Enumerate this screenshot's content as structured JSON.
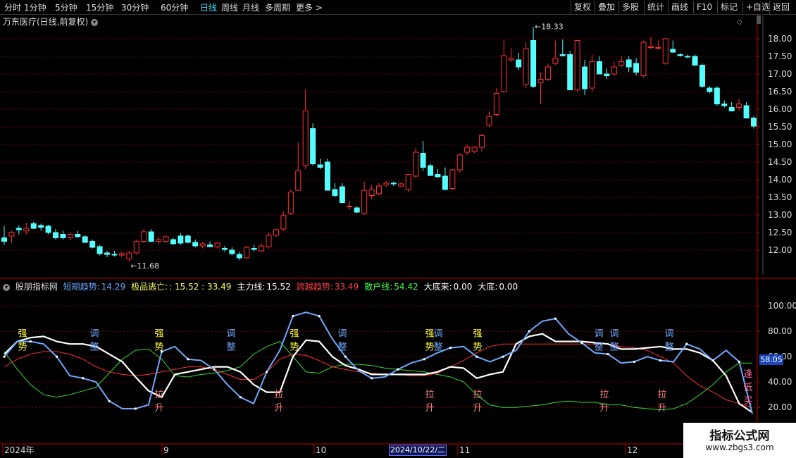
{
  "toolbar": {
    "tabs": [
      "分时",
      "1分钟",
      "5分钟",
      "15分钟",
      "30分钟",
      "60分钟",
      "日线",
      "周线",
      "月线",
      "多周期",
      "更多 >"
    ],
    "active_tab": "日线",
    "right_buttons": [
      "复权",
      "叠加",
      "多股",
      "统计",
      "画线",
      "F10",
      "标记",
      "+自选",
      "返回"
    ]
  },
  "stock_title": "万东医疗(日线,前复权)",
  "indicator_header": {
    "name": "股朋指标网",
    "items": [
      {
        "label": "短期趋势:",
        "value": "14.29",
        "color": "#6fa8ff"
      },
      {
        "label": "极品逃亡:",
        "value": ": 15.52 : 33.49",
        "color": "#ffff66"
      },
      {
        "label": "主力线:",
        "value": "15.52",
        "color": "#ffffff"
      },
      {
        "label": "跨越趋势:",
        "value": "33.49",
        "color": "#ff4444"
      },
      {
        "label": "散户线:",
        "value": "54.42",
        "color": "#44ff44"
      },
      {
        "label": "大底来:",
        "value": "0.00",
        "color": "#ffffff"
      },
      {
        "label": "大底:",
        "value": "0.00",
        "color": "#ffffff"
      }
    ]
  },
  "current_value_badge": "58.05",
  "date_badge": "2024/10/22/二",
  "watermark": {
    "title": "指标公式网",
    "url": "www.zbgs3.com"
  },
  "colors": {
    "up": "#ff3232",
    "down": "#54ffff",
    "grid": "#7a0000",
    "axis": "#c00000",
    "short": "#6fa8ff",
    "main": "#ffffff",
    "cross": "#ff3030",
    "retail": "#33dd33"
  },
  "chart_data": [
    {
      "type": "candlestick",
      "title": "万东医疗(日线,前复权)",
      "y_ticks": [
        12.0,
        12.5,
        13.0,
        13.5,
        14.0,
        14.5,
        15.0,
        15.5,
        16.0,
        16.5,
        17.0,
        17.5,
        18.0
      ],
      "ylim": [
        11.5,
        18.4
      ],
      "x_labels": [
        "2024年",
        "9",
        "10",
        "11",
        "12"
      ],
      "annotations": [
        {
          "text": "18.33",
          "price": 18.33
        },
        {
          "text": "11.68",
          "price": 11.68
        }
      ],
      "candles": [
        [
          12.35,
          12.68,
          12.15,
          12.25
        ],
        [
          12.4,
          12.55,
          12.2,
          12.5
        ],
        [
          12.62,
          12.7,
          12.45,
          12.58
        ],
        [
          12.55,
          12.78,
          12.45,
          12.62
        ],
        [
          12.75,
          12.8,
          12.6,
          12.62
        ],
        [
          12.7,
          12.75,
          12.55,
          12.65
        ],
        [
          12.68,
          12.72,
          12.45,
          12.5
        ],
        [
          12.5,
          12.6,
          12.3,
          12.35
        ],
        [
          12.45,
          12.55,
          12.3,
          12.35
        ],
        [
          12.35,
          12.48,
          12.28,
          12.45
        ],
        [
          12.45,
          12.55,
          12.35,
          12.38
        ],
        [
          12.38,
          12.42,
          12.2,
          12.22
        ],
        [
          12.25,
          12.3,
          12.05,
          12.08
        ],
        [
          12.1,
          12.15,
          11.85,
          11.9
        ],
        [
          11.92,
          11.98,
          11.8,
          11.88
        ],
        [
          11.88,
          11.98,
          11.82,
          11.86
        ],
        [
          11.86,
          11.95,
          11.8,
          11.9
        ],
        [
          11.75,
          11.98,
          11.68,
          11.92
        ],
        [
          11.92,
          12.3,
          11.88,
          12.25
        ],
        [
          12.25,
          12.6,
          12.2,
          12.52
        ],
        [
          12.52,
          12.6,
          12.22,
          12.25
        ],
        [
          12.25,
          12.38,
          12.18,
          12.3
        ],
        [
          12.25,
          12.42,
          12.2,
          12.38
        ],
        [
          12.3,
          12.35,
          12.15,
          12.18
        ],
        [
          12.4,
          12.48,
          12.15,
          12.2
        ],
        [
          12.4,
          12.45,
          12.2,
          12.22
        ],
        [
          12.22,
          12.3,
          12.08,
          12.12
        ],
        [
          12.12,
          12.22,
          12.05,
          12.18
        ],
        [
          12.15,
          12.25,
          12.08,
          12.1
        ],
        [
          12.1,
          12.22,
          12.05,
          12.2
        ],
        [
          12.05,
          12.12,
          11.95,
          12.02
        ],
        [
          12.0,
          12.08,
          11.85,
          11.9
        ],
        [
          11.88,
          11.95,
          11.72,
          11.78
        ],
        [
          11.78,
          12.12,
          11.75,
          12.08
        ],
        [
          12.05,
          12.15,
          11.95,
          12.02
        ],
        [
          11.98,
          12.2,
          11.95,
          12.12
        ],
        [
          12.1,
          12.5,
          12.05,
          12.42
        ],
        [
          12.42,
          12.62,
          12.38,
          12.58
        ],
        [
          12.6,
          13.1,
          12.55,
          12.98
        ],
        [
          13.05,
          13.72,
          13.0,
          13.65
        ],
        [
          13.7,
          15.05,
          13.68,
          14.25
        ],
        [
          14.4,
          16.55,
          14.3,
          15.95
        ],
        [
          15.45,
          15.6,
          14.4,
          14.45
        ],
        [
          14.42,
          14.6,
          14.3,
          14.35
        ],
        [
          14.5,
          14.6,
          13.7,
          13.7
        ],
        [
          13.72,
          13.9,
          13.5,
          13.55
        ],
        [
          13.8,
          13.9,
          13.35,
          13.35
        ],
        [
          13.25,
          13.4,
          13.15,
          13.25
        ],
        [
          13.2,
          13.25,
          13.05,
          13.08
        ],
        [
          13.05,
          13.95,
          13.0,
          13.7
        ],
        [
          13.55,
          13.85,
          13.45,
          13.72
        ],
        [
          13.6,
          13.9,
          13.55,
          13.82
        ],
        [
          13.85,
          13.95,
          13.8,
          13.9
        ],
        [
          13.9,
          13.95,
          13.82,
          13.88
        ],
        [
          13.82,
          13.92,
          13.78,
          13.88
        ],
        [
          13.72,
          14.15,
          13.65,
          14.15
        ],
        [
          14.1,
          14.9,
          14.05,
          14.78
        ],
        [
          14.75,
          15.1,
          14.25,
          14.35
        ],
        [
          14.4,
          14.45,
          14.1,
          14.12
        ],
        [
          14.15,
          14.3,
          14.05,
          14.08
        ],
        [
          14.1,
          14.35,
          13.7,
          13.72
        ],
        [
          13.75,
          14.3,
          13.72,
          14.28
        ],
        [
          14.28,
          14.75,
          14.2,
          14.7
        ],
        [
          14.78,
          15.0,
          14.7,
          14.92
        ],
        [
          14.8,
          14.95,
          14.75,
          14.92
        ],
        [
          14.92,
          15.3,
          14.8,
          15.25
        ],
        [
          15.55,
          15.95,
          15.5,
          15.8
        ],
        [
          15.85,
          16.6,
          15.8,
          16.45
        ],
        [
          16.5,
          17.98,
          16.45,
          17.52
        ],
        [
          17.4,
          17.75,
          17.35,
          17.45
        ],
        [
          17.4,
          17.6,
          17.1,
          17.2
        ],
        [
          16.7,
          17.9,
          16.6,
          17.72
        ],
        [
          17.95,
          18.33,
          16.6,
          16.65
        ],
        [
          16.75,
          17.05,
          16.15,
          16.85
        ],
        [
          16.85,
          17.3,
          16.8,
          17.2
        ],
        [
          17.3,
          17.95,
          17.25,
          17.45
        ],
        [
          17.55,
          17.98,
          17.5,
          17.52
        ],
        [
          17.55,
          17.65,
          16.55,
          16.55
        ],
        [
          16.55,
          17.95,
          16.5,
          17.95
        ],
        [
          17.2,
          17.4,
          16.4,
          16.58
        ],
        [
          16.6,
          17.55,
          16.5,
          17.35
        ],
        [
          17.35,
          17.5,
          17.0,
          17.0
        ],
        [
          17.0,
          17.15,
          16.85,
          16.95
        ],
        [
          17.0,
          17.35,
          16.95,
          17.2
        ],
        [
          17.25,
          17.5,
          17.2,
          17.35
        ],
        [
          17.4,
          17.5,
          17.05,
          17.2
        ],
        [
          17.3,
          17.45,
          16.95,
          17.05
        ],
        [
          16.95,
          17.95,
          16.9,
          17.9
        ],
        [
          17.75,
          18.05,
          17.7,
          17.78
        ],
        [
          17.75,
          17.95,
          17.7,
          17.75
        ],
        [
          17.3,
          18.0,
          17.25,
          18.0
        ],
        [
          17.7,
          17.95,
          17.6,
          17.62
        ],
        [
          17.55,
          17.6,
          17.5,
          17.52
        ],
        [
          17.5,
          17.55,
          17.45,
          17.48
        ],
        [
          17.5,
          17.55,
          17.25,
          17.25
        ],
        [
          17.25,
          17.3,
          16.6,
          16.65
        ],
        [
          16.6,
          16.65,
          16.45,
          16.5
        ],
        [
          16.6,
          16.65,
          16.1,
          16.15
        ],
        [
          16.15,
          16.25,
          16.05,
          16.1
        ],
        [
          16.05,
          16.2,
          15.95,
          15.95
        ],
        [
          16.05,
          16.3,
          15.95,
          16.15
        ],
        [
          16.1,
          16.2,
          15.75,
          15.75
        ],
        [
          15.75,
          15.8,
          15.45,
          15.52
        ]
      ]
    },
    {
      "type": "line",
      "title": "股朋指标网",
      "y_ticks": [
        20.0,
        40.0,
        60.0,
        80.0,
        100.0
      ],
      "ylim": [
        9,
        109
      ],
      "series": [
        {
          "name": "短期趋势",
          "color": "#6fa8ff",
          "marker": true,
          "values": [
            60,
            72,
            72,
            70,
            60,
            45,
            43,
            40,
            25,
            19,
            19,
            22,
            64,
            68,
            58,
            57,
            50,
            38,
            28,
            23,
            48,
            65,
            92,
            95,
            92,
            74,
            60,
            49,
            43,
            44,
            50,
            55,
            58,
            63,
            67,
            68,
            60,
            56,
            60,
            65,
            80,
            88,
            90,
            78,
            71,
            63,
            62,
            55,
            56,
            60,
            57,
            56,
            70,
            66,
            57,
            65,
            56,
            15
          ]
        },
        {
          "name": "主力线",
          "color": "#ffffff",
          "marker": false,
          "values": [
            62,
            72,
            75,
            76,
            72,
            70,
            70,
            68,
            62,
            56,
            44,
            33,
            28,
            46,
            48,
            50,
            52,
            52,
            48,
            38,
            32,
            32,
            60,
            73,
            72,
            60,
            53,
            50,
            46,
            46,
            46,
            46,
            46,
            48,
            52,
            51,
            43,
            46,
            48,
            70,
            76,
            78,
            72,
            72,
            72,
            71,
            70,
            66,
            66,
            67,
            68,
            66,
            66,
            63,
            57,
            45,
            23,
            16
          ]
        },
        {
          "name": "跨越趋势",
          "color": "#ff3030",
          "marker": false,
          "values": [
            52,
            58,
            62,
            64,
            64,
            62,
            58,
            52,
            48,
            46,
            45,
            46,
            48,
            50,
            52,
            52,
            50,
            46,
            42,
            42,
            48,
            58,
            62,
            61,
            57,
            52,
            50,
            48,
            47,
            46,
            46,
            45,
            45,
            47,
            52,
            57,
            63,
            68,
            70,
            70,
            70,
            70,
            70,
            70,
            70,
            70,
            70,
            68,
            67,
            65,
            60,
            55,
            45,
            37,
            32,
            26,
            23,
            20
          ]
        },
        {
          "name": "散户线",
          "color": "#33dd33",
          "marker": false,
          "values": [
            64,
            50,
            38,
            30,
            28,
            30,
            33,
            36,
            47,
            58,
            65,
            66,
            58,
            45,
            44,
            46,
            47,
            49,
            52,
            62,
            68,
            72,
            60,
            48,
            47,
            52,
            54,
            54,
            53,
            51,
            50,
            49,
            48,
            46,
            44,
            40,
            30,
            22,
            20,
            20,
            21,
            22,
            24,
            25,
            24,
            24,
            22,
            22,
            20,
            19,
            18,
            19,
            23,
            30,
            38,
            48,
            55,
            55
          ]
        }
      ],
      "labels": [
        {
          "text": "强",
          "sub": "势",
          "color": "#ffff33",
          "value": 76
        },
        {
          "text": "调",
          "sub": "整",
          "color": "#6fa8ff",
          "value": 76
        },
        {
          "text": "强",
          "sub": "势",
          "color": "#ffff33",
          "value": 76
        },
        {
          "text": "调",
          "sub": "整",
          "color": "#6fa8ff",
          "value": 76
        },
        {
          "text": "强",
          "sub": "势",
          "color": "#ffff33",
          "value": 76
        },
        {
          "text": "调",
          "sub": "整",
          "color": "#6fa8ff",
          "value": 76
        },
        {
          "text": "强",
          "sub": "势",
          "color": "#ffff33",
          "value": 76
        },
        {
          "text": "调",
          "sub": "整",
          "color": "#6fa8ff",
          "value": 76
        },
        {
          "text": "强",
          "sub": "势",
          "color": "#ffff33",
          "value": 76
        },
        {
          "text": "调",
          "sub": "整",
          "color": "#6fa8ff",
          "value": 76
        },
        {
          "text": "调",
          "sub": "整",
          "color": "#6fa8ff",
          "value": 76
        },
        {
          "text": "调",
          "sub": "整",
          "color": "#6fa8ff",
          "value": 76
        },
        {
          "text": "拉",
          "sub": "升",
          "color": "#ff8080",
          "value": 28
        },
        {
          "text": "拉",
          "sub": "升",
          "color": "#ff8080",
          "value": 28
        },
        {
          "text": "拉",
          "sub": "升",
          "color": "#ff8080",
          "value": 28
        },
        {
          "text": "拉",
          "sub": "升",
          "color": "#ff8080",
          "value": 28
        },
        {
          "text": "拉",
          "sub": "升",
          "color": "#ff8080",
          "value": 28
        },
        {
          "text": "拉",
          "sub": "升",
          "color": "#ff8080",
          "value": 28
        },
        {
          "text": "逢",
          "sub": "低",
          "extra": "买",
          "color": "#ff6699",
          "value": 44
        }
      ]
    }
  ]
}
